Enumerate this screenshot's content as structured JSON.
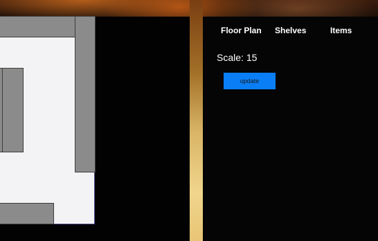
{
  "nav": {
    "tabs": [
      {
        "label": "Floor Plan"
      },
      {
        "label": "Shelves"
      },
      {
        "label": "Items"
      }
    ]
  },
  "controls": {
    "scale_label": "Scale:",
    "scale_value": "15",
    "update_label": "update"
  },
  "colors": {
    "button": "#0a7ef5",
    "floor": "#f3f3f5",
    "wall": "#8b8b8b",
    "panel": "#050505"
  }
}
